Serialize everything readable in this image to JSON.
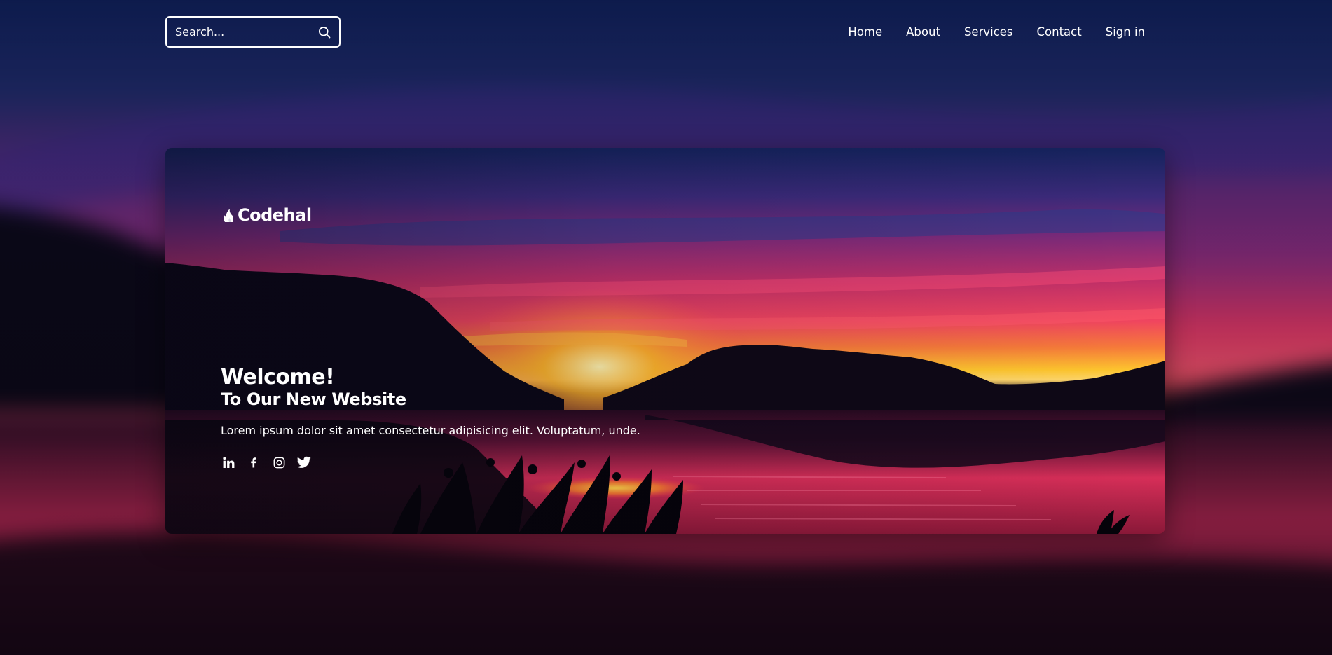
{
  "header": {
    "search": {
      "placeholder": "Search...",
      "value": ""
    },
    "nav": [
      {
        "label": "Home"
      },
      {
        "label": "About"
      },
      {
        "label": "Services"
      },
      {
        "label": "Contact"
      },
      {
        "label": "Sign in"
      }
    ]
  },
  "card": {
    "brand": {
      "name": "Codehal",
      "icon": "flame-logo-icon"
    },
    "hero": {
      "title": "Welcome!",
      "subtitle": "To Our New Website",
      "text": "Lorem ipsum dolor sit amet consectetur adipisicing elit. Voluptatum, unde."
    },
    "socials": [
      {
        "icon": "linkedin-icon"
      },
      {
        "icon": "facebook-icon"
      },
      {
        "icon": "instagram-icon"
      },
      {
        "icon": "twitter-icon"
      }
    ]
  },
  "colors": {
    "sky_top": "#0b1d52",
    "sky_mid": "#5a2a78",
    "sunset_pink": "#e8365f",
    "sunset_orange": "#ffb020",
    "mountain": "#0a0714",
    "text": "#ffffff"
  }
}
